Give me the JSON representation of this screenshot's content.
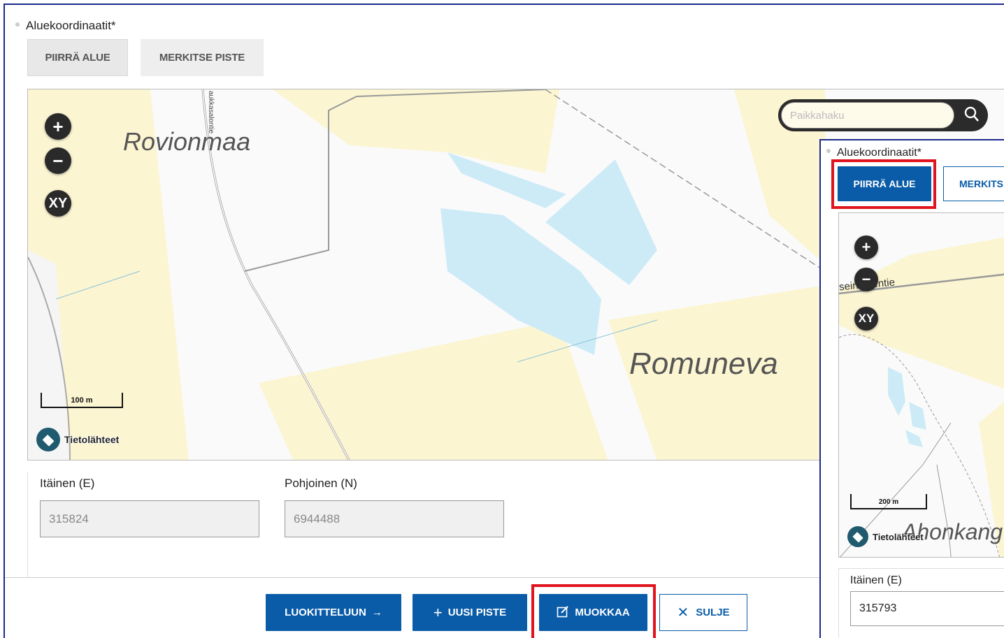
{
  "main": {
    "field_label": "Aluekoordinaatit",
    "required_mark": "*",
    "tabs": {
      "draw_area": "PIIRRÄ ALUE",
      "mark_point": "MERKITSE PISTE"
    },
    "map": {
      "search_placeholder": "Paikkahaku",
      "zoom_in": "+",
      "zoom_out": "−",
      "xy": "XY",
      "place_rovionmaa": "Rovionmaa",
      "place_romuneva": "Romuneva",
      "road_label": "aukkasalontie",
      "scale": "100 m",
      "source": "Tietolähteet"
    },
    "coords": {
      "east_label": "Itäinen (E)",
      "east_value": "315824",
      "north_label": "Pohjoinen (N)",
      "north_value": "6944488"
    },
    "footer": {
      "classify": "LUOKITTELUUN",
      "new_point": "UUSI PISTE",
      "edit": "MUOKKAA",
      "close": "SULJE"
    }
  },
  "inset": {
    "field_label": "Aluekoordinaatit",
    "required_mark": "*",
    "tabs": {
      "draw_area": "PIIRRÄ ALUE",
      "mark_point": "MERKITS"
    },
    "map": {
      "zoom_in": "+",
      "zoom_out": "−",
      "xy": "XY",
      "road_label": "seinäjoentie",
      "place_partial": "Ahonkang",
      "scale": "200 m",
      "source": "Tietolähteet"
    },
    "coords": {
      "east_label": "Itäinen (E)",
      "east_value": "315793"
    }
  },
  "colors": {
    "primary": "#0a5ca8",
    "highlight": "#e0141e",
    "field_yellow": "#fbf5d2",
    "water": "#cdebf7",
    "frame_border": "#1b2a8a"
  }
}
